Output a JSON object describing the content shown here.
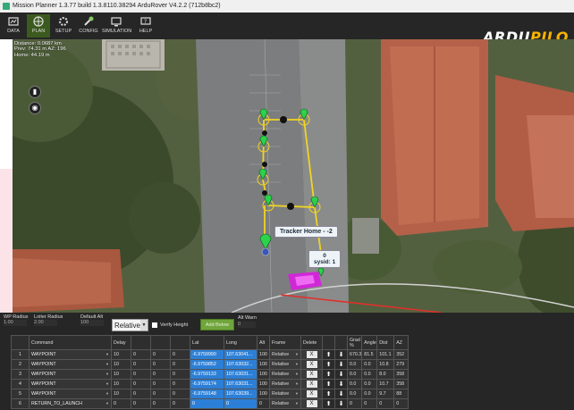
{
  "window": {
    "title": "Mission Planner 1.3.77 build 1.3.8110.38294 ArduRover V4.2.2 (712b8bc2)"
  },
  "toolbar": {
    "buttons": [
      {
        "label": "DATA",
        "icon": "data-icon"
      },
      {
        "label": "PLAN",
        "icon": "plan-icon"
      },
      {
        "label": "SETUP",
        "icon": "setup-icon"
      },
      {
        "label": "CONFIG",
        "icon": "config-icon"
      },
      {
        "label": "SIMULATION",
        "icon": "simulation-icon"
      },
      {
        "label": "HELP",
        "icon": "help-icon"
      }
    ],
    "active": "PLAN",
    "logo_main": "ARDU",
    "logo_accent": "PILO",
    "accent_color": "#f5b400"
  },
  "map": {
    "hud": {
      "distance": "Distance: 0.0687 km",
      "prev": "Prev: 74.31 m AZ: 196",
      "home": "Home: 44.19 m"
    },
    "tracker_label": "Tracker Home - -2",
    "sysid_line1": "0",
    "sysid_line2": "sysid: 1",
    "route_color": "#f2d322"
  },
  "options": {
    "wp_radius_label": "WP Radius",
    "wp_radius_value": "1.00",
    "loiter_radius_label": "Loiter Radius",
    "loiter_radius_value": "2.00",
    "default_alt_label": "Default Alt",
    "default_alt_value": "100",
    "alt_frame": "Relative",
    "verify_height": "Verify Height",
    "add_below": "Add Below",
    "alt_warn_label": "Alt Warn",
    "alt_warn_value": "0"
  },
  "table": {
    "headers": [
      "",
      "Command",
      "Delay",
      "",
      "",
      "",
      "Lat",
      "Long",
      "Alt",
      "Frame",
      "Delete",
      "",
      "",
      "Grad %",
      "Angle",
      "Dist",
      "AZ"
    ],
    "rows": [
      {
        "n": "1",
        "cmd": "WAYPOINT",
        "delay": "10",
        "p2": "0",
        "p3": "0",
        "p4": "0",
        "lat": "-6.9759990",
        "lng": "107.63041...",
        "alt": "100",
        "frame": "Relative",
        "grad": "670.3",
        "angle": "81.5",
        "dist": "101.1",
        "az": "352"
      },
      {
        "n": "2",
        "cmd": "WAYPOINT",
        "delay": "10",
        "p2": "0",
        "p3": "0",
        "p4": "0",
        "lat": "-6.9759852",
        "lng": "107.63032...",
        "alt": "100",
        "frame": "Relative",
        "grad": "0.0",
        "angle": "0.0",
        "dist": "10.8",
        "az": "279"
      },
      {
        "n": "3",
        "cmd": "WAYPOINT",
        "delay": "10",
        "p2": "0",
        "p3": "0",
        "p4": "0",
        "lat": "-6.9759133",
        "lng": "107.63031...",
        "alt": "100",
        "frame": "Relative",
        "grad": "0.0",
        "angle": "0.0",
        "dist": "8.0",
        "az": "358"
      },
      {
        "n": "4",
        "cmd": "WAYPOINT",
        "delay": "10",
        "p2": "0",
        "p3": "0",
        "p4": "0",
        "lat": "-6.9759174",
        "lng": "107.63031...",
        "alt": "100",
        "frame": "Relative",
        "grad": "0.0",
        "angle": "0.0",
        "dist": "10.7",
        "az": "358"
      },
      {
        "n": "5",
        "cmd": "WAYPOINT",
        "delay": "10",
        "p2": "0",
        "p3": "0",
        "p4": "0",
        "lat": "-6.9759148",
        "lng": "107.63039...",
        "alt": "100",
        "frame": "Relative",
        "grad": "0.0",
        "angle": "0.0",
        "dist": "9.7",
        "az": "88"
      },
      {
        "n": "6",
        "cmd": "RETURN_TO_LAUNCH",
        "delay": "0",
        "p2": "0",
        "p3": "0",
        "p4": "0",
        "lat": "0",
        "lng": "0",
        "alt": "0",
        "frame": "Relative",
        "grad": "0",
        "angle": "0",
        "dist": "0",
        "az": "0"
      }
    ],
    "delete_label": "X"
  }
}
